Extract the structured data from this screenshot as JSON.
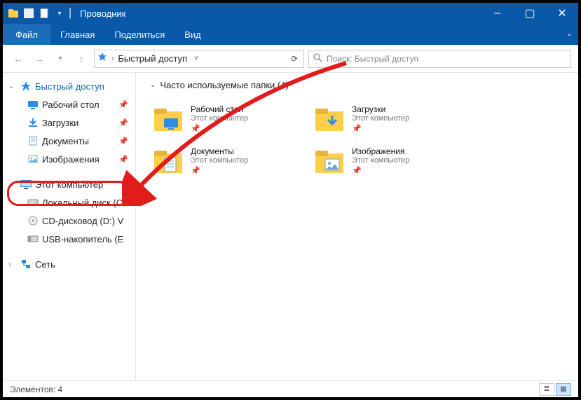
{
  "window": {
    "title": "Проводник",
    "minimize": "–",
    "maximize": "▢",
    "close": "✕"
  },
  "ribbon": {
    "file": "Файл",
    "tabs": [
      "Главная",
      "Поделиться",
      "Вид"
    ]
  },
  "address": {
    "location": "Быстрый доступ",
    "search_placeholder": "Поиск: Быстрый доступ"
  },
  "sidebar": {
    "quick_access": "Быстрый доступ",
    "quick_items": [
      {
        "label": "Рабочий стол",
        "icon": "desktop"
      },
      {
        "label": "Загрузки",
        "icon": "downloads"
      },
      {
        "label": "Документы",
        "icon": "documents"
      },
      {
        "label": "Изображения",
        "icon": "pictures"
      }
    ],
    "this_pc": "Этот компьютер",
    "pc_items": [
      {
        "label": "Локальный диск (C",
        "icon": "hdd"
      },
      {
        "label": "CD-дисковод (D:) V",
        "icon": "cd"
      },
      {
        "label": "USB-накопитель (E",
        "icon": "usb"
      }
    ],
    "network": "Сеть"
  },
  "content": {
    "section_title": "Часто используемые папки (4)",
    "folders": [
      {
        "name": "Рабочий стол",
        "sub": "Этот компьютер",
        "icon": "desktop"
      },
      {
        "name": "Загрузки",
        "sub": "Этот компьютер",
        "icon": "downloads"
      },
      {
        "name": "Документы",
        "sub": "Этот компьютер",
        "icon": "documents"
      },
      {
        "name": "Изображения",
        "sub": "Этот компьютер",
        "icon": "pictures"
      }
    ]
  },
  "statusbar": {
    "text": "Элементов: 4"
  }
}
